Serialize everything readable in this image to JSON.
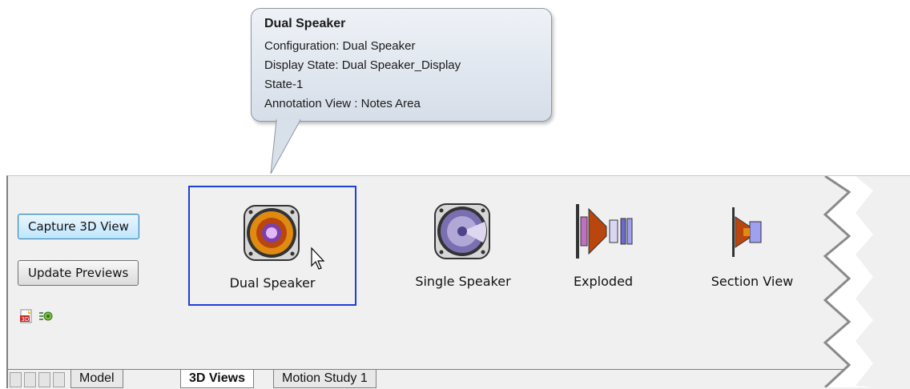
{
  "tooltip": {
    "title": "Dual Speaker",
    "line1": "Configuration:  Dual Speaker",
    "line2": "Display State:  Dual Speaker_Display",
    "line3": "State-1",
    "line4": "Annotation View :  Notes Area"
  },
  "buttons": {
    "capture": "Capture 3D View",
    "update": "Update Previews"
  },
  "views": [
    {
      "label": "Dual Speaker",
      "selected": true
    },
    {
      "label": "Single Speaker",
      "selected": false
    },
    {
      "label": "Exploded",
      "selected": false
    },
    {
      "label": "Section View",
      "selected": false
    }
  ],
  "tabs": [
    {
      "label": "Model",
      "active": false
    },
    {
      "label": "3D Views",
      "active": true
    },
    {
      "label": "Motion Study 1",
      "active": false
    }
  ],
  "icons": {
    "publish": "3d-pdf-icon",
    "list": "config-list-icon",
    "collapse": "double-chevron-down-icon"
  },
  "colors": {
    "selection_border": "#1f3fd6",
    "panel_bg": "#f0f0f0"
  }
}
